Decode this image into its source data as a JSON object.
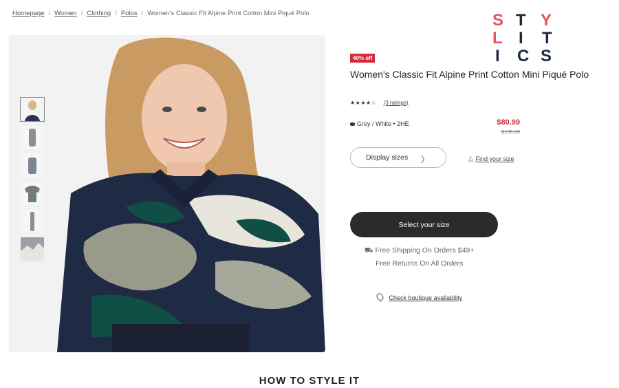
{
  "breadcrumb": {
    "items": [
      "Homepage",
      "Women",
      "Clothing",
      "Polos"
    ],
    "current": "Women's Classic Fit Alpine Print Cotton Mini Piqué Polo"
  },
  "logo": {
    "letters": [
      "S",
      "T",
      "Y",
      "L",
      "I",
      "T",
      "I",
      "C",
      "S"
    ],
    "colors": {
      "pink": "#e8525e",
      "navy": "#1e2a3e"
    }
  },
  "product": {
    "badge": "40% off",
    "title": "Women's Classic Fit Alpine Print Cotton Mini Piqué Polo",
    "rating_stars": 4,
    "stars_glyphs": "★★★★☆",
    "ratings_link": "(3 ratings)",
    "color_label": "Grey / White • 2HE",
    "price_now": "$80.99",
    "price_was": "$135.00",
    "thumbnail_count": 6,
    "active_thumbnail": 0
  },
  "actions": {
    "display_sizes": "Display sizes",
    "find_size": "Find your size",
    "select_size": "Select your size",
    "shipping_line1": "Free Shipping On Orders $49+",
    "shipping_line2": "Free Returns On All Orders",
    "check_boutique": "Check boutique availability"
  },
  "section": {
    "style_heading": "HOW TO STYLE IT"
  },
  "colors": {
    "accent_red": "#d6283a",
    "button_dark": "#2b2b2b"
  }
}
